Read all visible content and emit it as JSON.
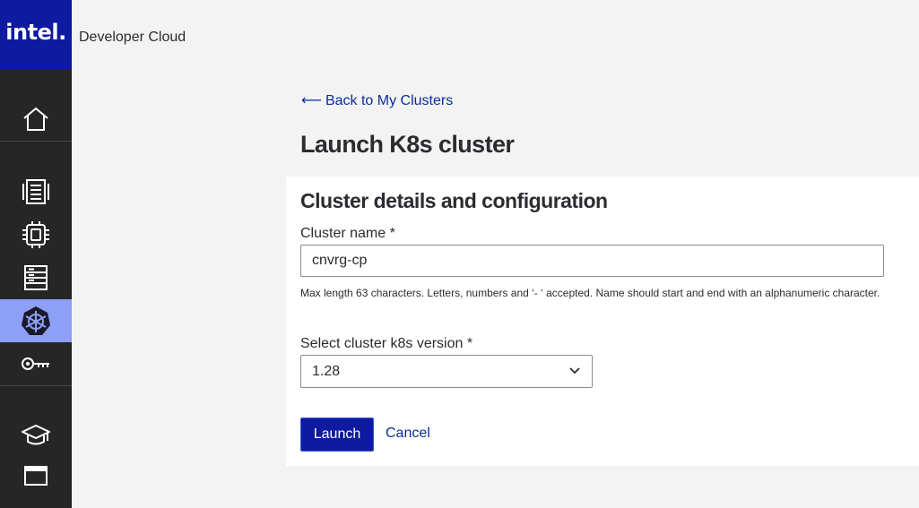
{
  "brand": {
    "logo_text": "intel.",
    "app_title": "Developer Cloud"
  },
  "sidebar": {
    "items": [
      {
        "icon": "home-icon",
        "active": false
      },
      {
        "icon": "server-rack-icon",
        "active": false
      },
      {
        "icon": "cpu-chip-icon",
        "active": false
      },
      {
        "icon": "storage-icon",
        "active": false
      },
      {
        "icon": "kubernetes-icon",
        "active": true
      },
      {
        "icon": "key-icon",
        "active": false
      },
      {
        "icon": "learning-cap-icon",
        "active": false
      },
      {
        "icon": "browser-window-icon",
        "active": false
      }
    ],
    "accent_active": "#8ea0f5",
    "background": "#262626"
  },
  "nav": {
    "back_arrow": "⟵",
    "back_label": "Back to My Clusters"
  },
  "page": {
    "title": "Launch K8s cluster"
  },
  "form": {
    "section_title": "Cluster details and configuration",
    "cluster_name_label": "Cluster name *",
    "cluster_name_value": "cnvrg-cp",
    "cluster_name_help": "Max length 63 characters. Letters, numbers and ‘- ‘ accepted. Name should start and end with an alphanumeric character.",
    "version_label": "Select cluster k8s version *",
    "version_value": "1.28",
    "launch_label": "Launch",
    "cancel_label": "Cancel"
  },
  "colors": {
    "brand_blue": "#0e1aa0",
    "link_blue": "#0b2d9b",
    "page_bg": "#f3f3f3"
  }
}
